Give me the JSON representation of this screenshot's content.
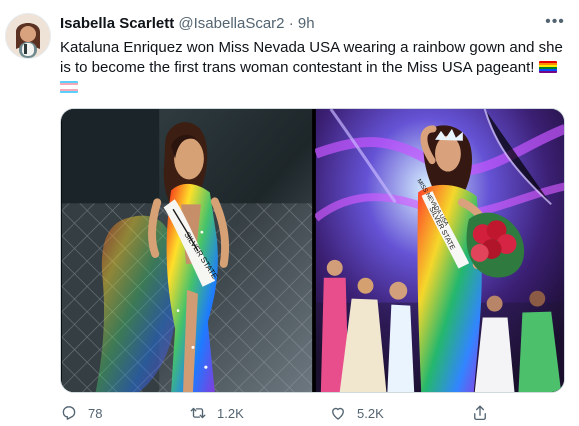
{
  "tweet": {
    "author_name": "Isabella Scarlett",
    "handle": "@IsabellaScar2",
    "separator": "·",
    "time": "9h",
    "more_icon": "ellipsis-icon",
    "text": "Kataluna Enriquez won Miss Nevada USA wearing a rainbow gown and she is to become the first trans woman contestant in the Miss USA pageant!",
    "emojis": [
      "rainbow-flag-icon",
      "transgender-flag-icon"
    ],
    "media": {
      "left_sash_text": "SILVER STATE",
      "right_sash_text": "SILVER STATE",
      "right_background_sash_text": "MISS NEVADA USA"
    },
    "actions": {
      "reply_count": "78",
      "retweet_count": "1.2K",
      "like_count": "5.2K"
    }
  },
  "colors": {
    "text": "#0f1419",
    "secondary": "#536471",
    "border": "#cfd9de"
  }
}
